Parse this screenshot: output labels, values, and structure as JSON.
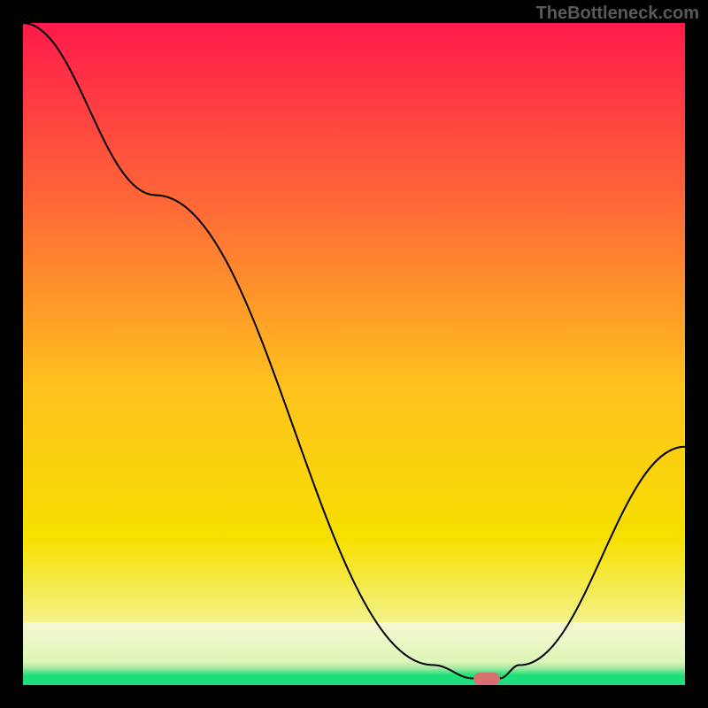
{
  "watermark": "TheBottleneck.com",
  "colors": {
    "top": "#ff1a4b",
    "upper": "#ff7d2e",
    "mid": "#ffd400",
    "lower": "#f6f06a",
    "pale": "#f7f7c8",
    "green": "#1ee07a",
    "line": "#000000",
    "marker": "#d96f6f",
    "frame": "#000000"
  },
  "chart_data": {
    "type": "line",
    "title": "",
    "xlabel": "",
    "ylabel": "",
    "xlim": [
      0,
      100
    ],
    "ylim": [
      0,
      100
    ],
    "x": [
      0,
      20,
      62,
      68,
      72,
      75,
      100
    ],
    "values": [
      100,
      74,
      3,
      1,
      1,
      3,
      36
    ],
    "marker": {
      "x": 70,
      "y": 1
    },
    "annotations": [
      "TheBottleneck.com"
    ]
  }
}
